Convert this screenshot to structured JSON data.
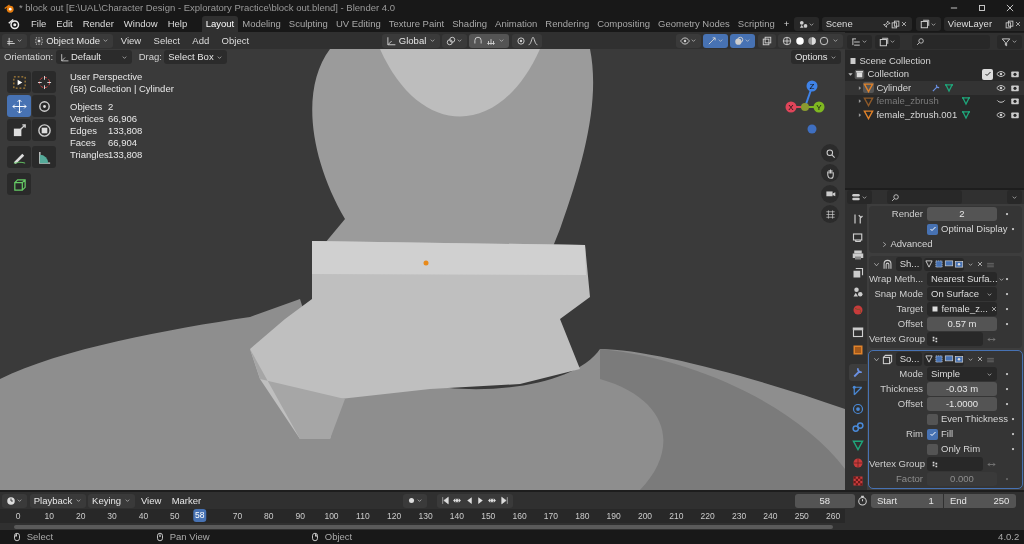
{
  "window": {
    "title": "* block out [E:\\UAL\\Character Design - Exploratory Practice\\block out.blend] - Blender 4.0"
  },
  "menu": [
    "File",
    "Edit",
    "Render",
    "Window",
    "Help"
  ],
  "workspaces": [
    {
      "label": "Layout",
      "selected": true
    },
    {
      "label": "Modeling",
      "selected": false
    },
    {
      "label": "Sculpting",
      "selected": false
    },
    {
      "label": "UV Editing",
      "selected": false
    },
    {
      "label": "Texture Paint",
      "selected": false
    },
    {
      "label": "Shading",
      "selected": false
    },
    {
      "label": "Animation",
      "selected": false
    },
    {
      "label": "Rendering",
      "selected": false
    },
    {
      "label": "Compositing",
      "selected": false
    },
    {
      "label": "Geometry Nodes",
      "selected": false
    },
    {
      "label": "Scripting",
      "selected": false
    }
  ],
  "add_workspace": "+",
  "scene": "Scene",
  "view_layer": "ViewLayer",
  "viewport": {
    "mode": "Object Mode",
    "menus": [
      "View",
      "Select",
      "Add",
      "Object"
    ],
    "transform": "Global",
    "orientation_label": "Orientation:",
    "orientation": "Default",
    "drag_label": "Drag:",
    "drag": "Select Box",
    "options": "Options",
    "info": {
      "view": "User Perspective",
      "context": "(58) Collection | Cylinder",
      "stats": [
        {
          "label": "Objects",
          "value": "2"
        },
        {
          "label": "Vertices",
          "value": "66,906"
        },
        {
          "label": "Edges",
          "value": "133,808"
        },
        {
          "label": "Faces",
          "value": "66,904"
        },
        {
          "label": "Triangles",
          "value": "133,808"
        }
      ]
    },
    "tools": [
      {
        "kind": "select_box",
        "selected": false
      },
      {
        "kind": "cursor",
        "selected": false
      },
      {
        "kind": "move",
        "selected": true
      },
      {
        "kind": "rotate",
        "selected": false
      },
      {
        "kind": "scale",
        "selected": false
      },
      {
        "kind": "transform",
        "selected": false
      },
      {
        "kind": "annotate",
        "selected": false
      },
      {
        "kind": "measure",
        "selected": false
      },
      {
        "kind": "add_cube",
        "selected": false
      }
    ],
    "axes": [
      {
        "label": "X",
        "color": "#e0455a"
      },
      {
        "label": "Y",
        "color": "#7fb821"
      },
      {
        "label": "Z",
        "color": "#3f83e8"
      }
    ]
  },
  "outliner": {
    "root": "Scene Collection",
    "collection": {
      "label": "Collection",
      "checked": true,
      "expanded": true,
      "children": [
        {
          "label": "Cylinder",
          "modifier": true,
          "hidden": false
        },
        {
          "label": "female_zbrush",
          "modifier": false,
          "hidden": true
        },
        {
          "label": "female_zbrush.001",
          "modifier": false,
          "hidden": false
        }
      ]
    }
  },
  "properties": {
    "tabs": [
      {
        "kind": "tool",
        "selected": false
      },
      {
        "kind": "render",
        "selected": false
      },
      {
        "kind": "output",
        "selected": false
      },
      {
        "kind": "view_layer",
        "selected": false
      },
      {
        "kind": "scene",
        "selected": false
      },
      {
        "kind": "world",
        "selected": false
      },
      {
        "kind": "collection",
        "selected": false
      },
      {
        "kind": "object",
        "selected": false
      },
      {
        "kind": "modifiers",
        "selected": true
      },
      {
        "kind": "particles",
        "selected": false
      },
      {
        "kind": "physics",
        "selected": false
      },
      {
        "kind": "constraints",
        "selected": false
      },
      {
        "kind": "data",
        "selected": false
      },
      {
        "kind": "material",
        "selected": false
      },
      {
        "kind": "texture",
        "selected": false
      }
    ],
    "top_rows": [
      {
        "kind": "number",
        "label": "Render",
        "value": "2",
        "disabled": false
      },
      {
        "kind": "checkbox",
        "label": "",
        "text": "Optimal Display",
        "checked": true,
        "disabled": false
      }
    ],
    "advanced": {
      "label": "Advanced",
      "expanded": false
    },
    "modifiers": [
      {
        "kind": "shrinkwrap",
        "name": "Sh...",
        "expanded": true,
        "active": false,
        "rows": [
          {
            "kind": "dropdown",
            "label": "Wrap Meth...",
            "value": "Nearest Surfa...",
            "disabled": false
          },
          {
            "kind": "dropdown",
            "label": "Snap Mode",
            "value": "On Surface",
            "disabled": false
          },
          {
            "kind": "object",
            "label": "Target",
            "value": "female_z...",
            "disabled": false
          },
          {
            "kind": "number",
            "label": "Offset",
            "value": "0.57 m",
            "disabled": false
          },
          {
            "kind": "vgroup",
            "label": "Vertex Group",
            "disabled": false
          }
        ]
      },
      {
        "kind": "solidify",
        "name": "So...",
        "expanded": true,
        "active": true,
        "rows": [
          {
            "kind": "dropdown",
            "label": "Mode",
            "value": "Simple",
            "disabled": false
          },
          {
            "kind": "number",
            "label": "Thickness",
            "value": "-0.03 m",
            "disabled": false
          },
          {
            "kind": "number",
            "label": "Offset",
            "value": "-1.0000",
            "disabled": false
          },
          {
            "kind": "checkbox",
            "label": "",
            "text": "Even Thickness",
            "checked": false,
            "disabled": false
          },
          {
            "kind": "checkbox",
            "label": "Rim",
            "text": "Fill",
            "checked": true,
            "disabled": false
          },
          {
            "kind": "checkbox",
            "label": "",
            "text": "Only Rim",
            "checked": false,
            "disabled": false
          },
          {
            "kind": "vgroup",
            "label": "Vertex Group",
            "disabled": false
          },
          {
            "kind": "number",
            "label": "Factor",
            "value": "0.000",
            "disabled": true
          }
        ]
      }
    ]
  },
  "timeline": {
    "menus": [
      "Playback",
      "Keying",
      "View",
      "Marker"
    ],
    "frame": "58",
    "start_label": "Start",
    "start": "1",
    "end_label": "End",
    "end": "250",
    "current": "58",
    "ticks": [
      "0",
      "10",
      "20",
      "30",
      "40",
      "50",
      "70",
      "80",
      "90",
      "100",
      "110",
      "120",
      "130",
      "140",
      "150",
      "160",
      "170",
      "180",
      "190",
      "200",
      "210",
      "220",
      "230",
      "240",
      "250",
      "260"
    ]
  },
  "status": {
    "items": [
      {
        "kind": "left",
        "label": "Select"
      },
      {
        "kind": "middle",
        "label": "Pan View"
      },
      {
        "kind": "right",
        "label": "Object"
      }
    ],
    "version": "4.0.2"
  }
}
